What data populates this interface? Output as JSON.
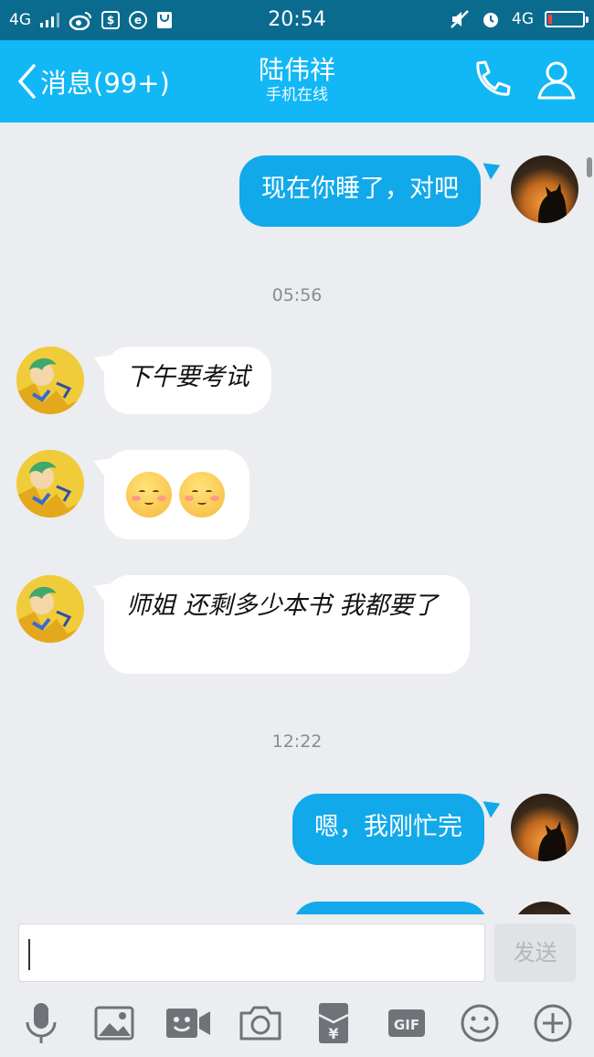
{
  "status_bar": {
    "network": "4G",
    "time": "20:54",
    "network_right": "4G",
    "icons": [
      "weibo-icon",
      "finance-app-icon",
      "browser-icon",
      "bag-icon",
      "mute-icon",
      "alarm-icon",
      "battery-icon"
    ]
  },
  "header": {
    "back_label": "消息(99+)",
    "contact_name": "陆伟祥",
    "contact_status": "手机在线",
    "call_icon": "phone-icon",
    "profile_icon": "person-icon"
  },
  "messages": [
    {
      "direction": "out",
      "text": "现在你睡了，对吧"
    },
    {
      "type": "timestamp",
      "text": "05:56"
    },
    {
      "direction": "in",
      "text": "下午要考试"
    },
    {
      "direction": "in",
      "type": "emoji",
      "emoji": [
        "shy-smile-emoji",
        "shy-smile-emoji"
      ]
    },
    {
      "direction": "in",
      "text": "师姐 还剩多少本书 我都要了"
    },
    {
      "type": "timestamp",
      "text": "12:22"
    },
    {
      "direction": "out",
      "text": "嗯，我刚忙完"
    }
  ],
  "composer": {
    "input_value": "",
    "send_label": "发送"
  },
  "toolbar": {
    "items": [
      "microphone-icon",
      "image-icon",
      "video-call-icon",
      "camera-icon",
      "red-packet-icon",
      "gif-icon",
      "emoji-icon",
      "plus-icon"
    ],
    "gif_label": "GIF",
    "red_packet_symbol": "¥"
  },
  "colors": {
    "status_bar": "#0b6b8f",
    "header": "#12b7f5",
    "outgoing_bubble": "#12a9ea",
    "incoming_bubble": "#ffffff",
    "chat_background": "#ebedf0"
  }
}
